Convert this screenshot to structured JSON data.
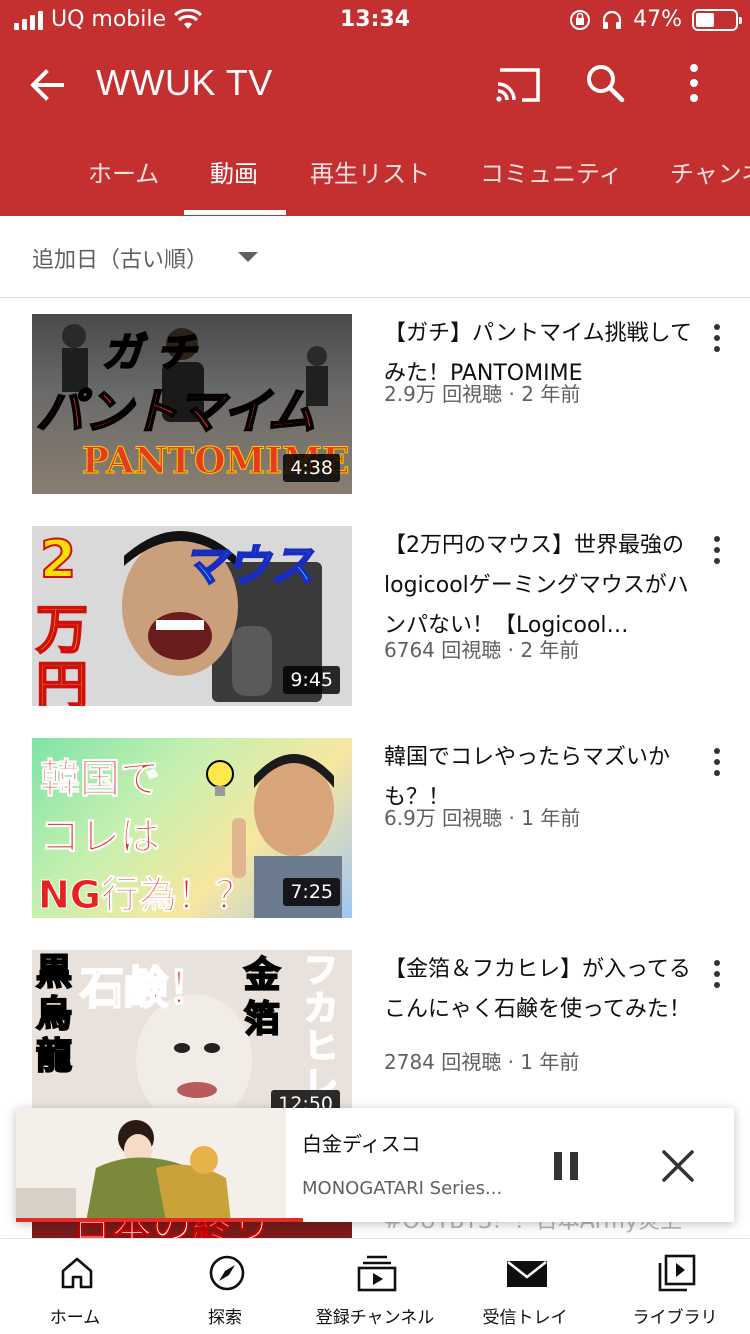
{
  "status": {
    "carrier": "UQ mobile",
    "time": "13:34",
    "battery": "47%",
    "battery_level": 0.47
  },
  "toolbar": {
    "title": "WWUK TV"
  },
  "tabs": [
    {
      "label": "ホーム"
    },
    {
      "label": "動画"
    },
    {
      "label": "再生リスト"
    },
    {
      "label": "コミュニティ"
    },
    {
      "label": "チャンネル"
    }
  ],
  "sort": {
    "label": "追加日（古い順）"
  },
  "videos": [
    {
      "title": "【ガチ】パントマイム挑戦してみた！PANTOMIME",
      "meta": "2.9万 回視聴 · 2 年前",
      "duration": "4:38",
      "thumb_text": [
        "ガ チ",
        "パントマイム",
        "PANTOMIME"
      ]
    },
    {
      "title": "【2万円のマウス】世界最強のlogicoolゲーミングマウスがハンパない！【Logicool…",
      "meta": "6764 回視聴 · 2 年前",
      "duration": "9:45",
      "thumb_text": [
        "2",
        "万",
        "円",
        "マウス"
      ]
    },
    {
      "title": "韓国でコレやったらマズいかも？！",
      "meta": "6.9万 回視聴 · 1 年前",
      "duration": "7:25",
      "thumb_text": [
        "韓国で",
        "コレは",
        "NG行為！？"
      ]
    },
    {
      "title": "【金箔＆フカヒレ】が入ってるこんにゃく石鹸を使ってみた！",
      "meta": "2784 回視聴 · 1 年前",
      "duration": "12:50",
      "thumb_text": [
        "黒",
        "烏",
        "龍",
        "石鹸！",
        "金",
        "箔",
        "フカヒレ"
      ]
    },
    {
      "title": "【BTS国連スピーチ】#OUTBTS？！日本Army炎上",
      "meta": "",
      "duration": "",
      "thumb_text": [
        "日本の終り"
      ]
    }
  ],
  "miniplayer": {
    "title": "白金ディスコ",
    "subtitle": "MONOGATARI Series...",
    "progress": 0.4
  },
  "bottomnav": [
    {
      "label": "ホーム",
      "icon": "home-icon"
    },
    {
      "label": "探索",
      "icon": "explore-icon"
    },
    {
      "label": "登録チャンネル",
      "icon": "subscriptions-icon"
    },
    {
      "label": "受信トレイ",
      "icon": "inbox-icon"
    },
    {
      "label": "ライブラリ",
      "icon": "library-icon"
    }
  ],
  "colors": {
    "brand": "#c4302f",
    "progress": "#e52d27"
  }
}
